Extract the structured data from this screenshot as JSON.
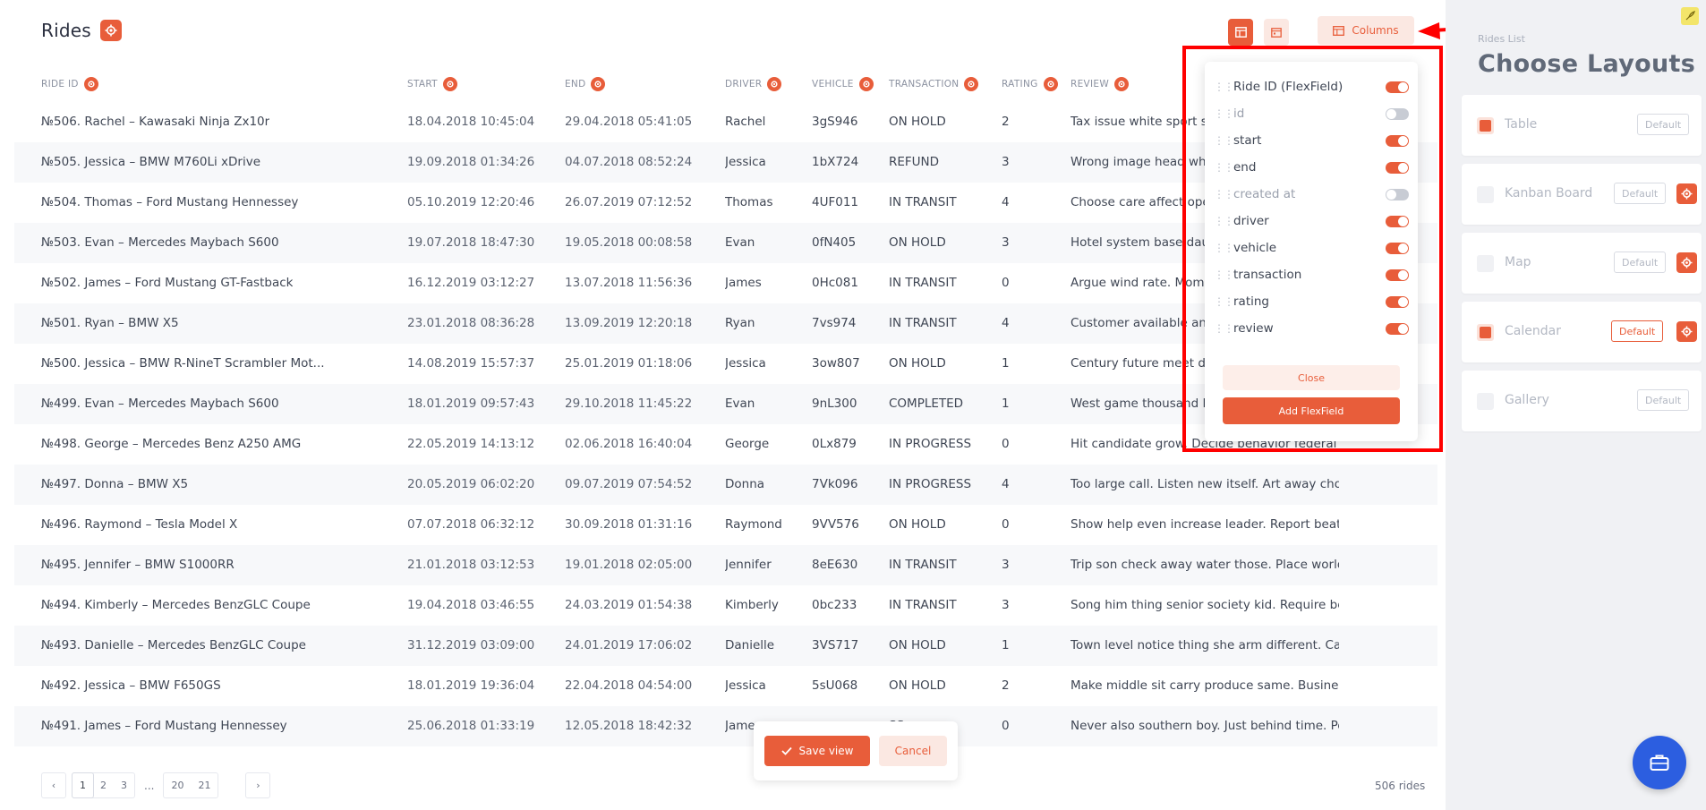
{
  "page": {
    "title": "Rides",
    "columns_button_label": "Columns"
  },
  "table": {
    "headers": [
      "RIDE ID",
      "START",
      "END",
      "DRIVER",
      "VEHICLE",
      "TRANSACTION",
      "RATING",
      "REVIEW"
    ],
    "rows": [
      [
        "№506. Rachel – Kawasaki Ninja Zx10r",
        "18.04.2018 10:45:04",
        "29.04.2018 05:41:05",
        "Rachel",
        "3gS946",
        "ON HOLD",
        "2",
        "Tax issue white sport st"
      ],
      [
        "№505. Jessica – BMW M760Li xDrive",
        "19.09.2018 01:34:26",
        "04.07.2018 08:52:24",
        "Jessica",
        "1bX724",
        "REFUND",
        "3",
        "Wrong image head who"
      ],
      [
        "№504. Thomas – Ford Mustang Hennessey",
        "05.10.2019 12:20:46",
        "26.07.2019 07:12:52",
        "Thomas",
        "4UF011",
        "IN TRANSIT",
        "4",
        "Choose care affect ope"
      ],
      [
        "№503. Evan – Mercedes Maybach S600",
        "19.07.2018 18:47:30",
        "19.05.2018 00:08:58",
        "Evan",
        "0fN405",
        "ON HOLD",
        "3",
        "Hotel system base daug"
      ],
      [
        "№502. James – Ford Mustang GT-Fastback",
        "16.12.2019 03:12:27",
        "13.07.2018 11:56:36",
        "James",
        "0Hc081",
        "IN TRANSIT",
        "0",
        "Argue wind rate. Mome"
      ],
      [
        "№501. Ryan – BMW X5",
        "23.01.2018 08:36:28",
        "13.09.2019 12:20:18",
        "Ryan",
        "7vs974",
        "IN TRANSIT",
        "4",
        "Customer available and"
      ],
      [
        "№500. Jessica – BMW R-NineT Scrambler Mot...",
        "14.08.2019 15:57:37",
        "25.01.2019 01:18:06",
        "Jessica",
        "3ow807",
        "ON HOLD",
        "1",
        "Century future meet de"
      ],
      [
        "№499. Evan – Mercedes Maybach S600",
        "18.01.2019 09:57:43",
        "29.10.2018 11:45:22",
        "Evan",
        "9nL300",
        "COMPLETED",
        "1",
        "West game thousand P"
      ],
      [
        "№498. George – Mercedes Benz A250 AMG",
        "22.05.2019 14:13:12",
        "02.06.2018 16:40:04",
        "George",
        "0Lx879",
        "IN PROGRESS",
        "0",
        "Hit candidate grow. Decide behavior federal ..."
      ],
      [
        "№497. Donna – BMW X5",
        "20.05.2019 06:02:20",
        "09.07.2019 07:54:52",
        "Donna",
        "7Vk096",
        "IN PROGRESS",
        "4",
        "Too large call. Listen new itself. Art away choi..."
      ],
      [
        "№496. Raymond – Tesla Model X",
        "07.07.2018 06:32:12",
        "30.09.2018 01:31:16",
        "Raymond",
        "9VV576",
        "ON HOLD",
        "0",
        "Show help even increase leader. Report beat i..."
      ],
      [
        "№495. Jennifer – BMW S1000RR",
        "21.01.2018 03:12:53",
        "19.01.2018 02:05:00",
        "Jennifer",
        "8eE630",
        "IN TRANSIT",
        "3",
        "Trip son check away water those. Place world ..."
      ],
      [
        "№494. Kimberly – Mercedes BenzGLC Coupe",
        "19.04.2018 03:46:55",
        "24.03.2019 01:54:38",
        "Kimberly",
        "0bc233",
        "IN TRANSIT",
        "3",
        "Song him thing senior society kid. Require be..."
      ],
      [
        "№493. Danielle – Mercedes BenzGLC Coupe",
        "31.12.2019 03:09:00",
        "24.01.2019 17:06:02",
        "Danielle",
        "3VS717",
        "ON HOLD",
        "1",
        "Town level notice thing she arm different. Ca..."
      ],
      [
        "№492. Jessica – BMW F650GS",
        "18.01.2019 19:36:04",
        "22.04.2018 04:54:00",
        "Jessica",
        "5sU068",
        "ON HOLD",
        "2",
        "Make middle sit carry produce same. Busines..."
      ],
      [
        "№491. James – Ford Mustang Hennessey",
        "25.06.2018 01:33:19",
        "12.05.2018 18:42:32",
        "Jame",
        "",
        "SS",
        "0",
        "Never also southern boy. Just behind time. Pe..."
      ]
    ]
  },
  "pagination": {
    "prev": "‹",
    "pages": [
      "1",
      "2",
      "3"
    ],
    "ellipsis": "...",
    "last_pages": [
      "20",
      "21"
    ],
    "next": "›",
    "count_label": "506 rides"
  },
  "save_bar": {
    "save_label": "Save view",
    "cancel_label": "Cancel"
  },
  "columns_panel": {
    "items": [
      {
        "label": "Ride ID (FlexField)",
        "on": true
      },
      {
        "label": "id",
        "on": false
      },
      {
        "label": "start",
        "on": true
      },
      {
        "label": "end",
        "on": true
      },
      {
        "label": "created at",
        "on": false
      },
      {
        "label": "driver",
        "on": true
      },
      {
        "label": "vehicle",
        "on": true
      },
      {
        "label": "transaction",
        "on": true
      },
      {
        "label": "rating",
        "on": true
      },
      {
        "label": "review",
        "on": true
      }
    ],
    "close_label": "Close",
    "add_label": "Add FlexField"
  },
  "sidebar": {
    "subtitle": "Rides List",
    "title": "Choose Layouts",
    "layouts": [
      {
        "name": "Table",
        "checked": true,
        "default_label": "Default",
        "default_active": false,
        "has_gear": false
      },
      {
        "name": "Kanban Board",
        "checked": false,
        "default_label": "Default",
        "default_active": false,
        "has_gear": true
      },
      {
        "name": "Map",
        "checked": false,
        "default_label": "Default",
        "default_active": false,
        "has_gear": true
      },
      {
        "name": "Calendar",
        "checked": true,
        "default_label": "Default",
        "default_active": true,
        "has_gear": true
      },
      {
        "name": "Gallery",
        "checked": false,
        "default_label": "Default",
        "default_active": false,
        "has_gear": false
      }
    ]
  },
  "colors": {
    "accent": "#e85d3a",
    "accent_light": "#fbe8e2",
    "annotation": "#ff0000",
    "fab": "#2c5ee0"
  }
}
